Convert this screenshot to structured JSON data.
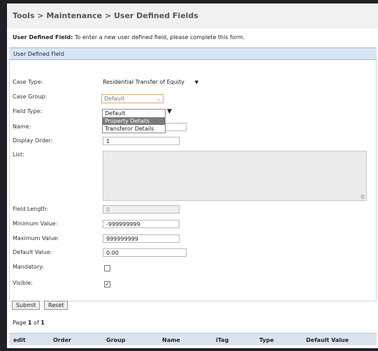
{
  "breadcrumb": "Tools > Maintenance > User Defined Fields",
  "intro": {
    "label": "User Defined Field:",
    "text": " To enter a new user defined field, please complete this form."
  },
  "section_title": "User Defined Field",
  "fields": {
    "case_type": {
      "label": "Case Type:",
      "value": "Residential Transfer of Equity"
    },
    "case_group": {
      "label": "Case Group:",
      "value": "Default"
    },
    "field_type": {
      "label": "Field Type:"
    },
    "name": {
      "label": "Name:",
      "value": ""
    },
    "display_order": {
      "label": "Display Order:",
      "value": "1"
    },
    "list": {
      "label": "List:",
      "value": ""
    },
    "field_length": {
      "label": "Field Length:",
      "value": "0"
    },
    "minimum_value": {
      "label": "Minimum Value:",
      "value": "-999999999"
    },
    "maximum_value": {
      "label": "Maximum Value:",
      "value": "999999999"
    },
    "default_value": {
      "label": "Default Value:",
      "value": "0.00"
    },
    "mandatory": {
      "label": "Mandatory:",
      "checked": false
    },
    "visible": {
      "label": "Visible:",
      "checked": true
    }
  },
  "case_group_options": [
    "Default",
    "Property Details",
    "Transferor Details"
  ],
  "case_group_highlighted": "Property Details",
  "buttons": {
    "submit": "Submit",
    "reset": "Reset"
  },
  "pager": {
    "prefix": "Page ",
    "current": "1",
    "of": " of ",
    "total": "1"
  },
  "table_headers": [
    "edit",
    "Order",
    "Group",
    "Name",
    "iTag",
    "Type",
    "Default Value"
  ],
  "colors": {
    "section_bar": "#d9e6f5",
    "highlight": "#7a7a7a",
    "focus_border": "#e0a86b"
  }
}
